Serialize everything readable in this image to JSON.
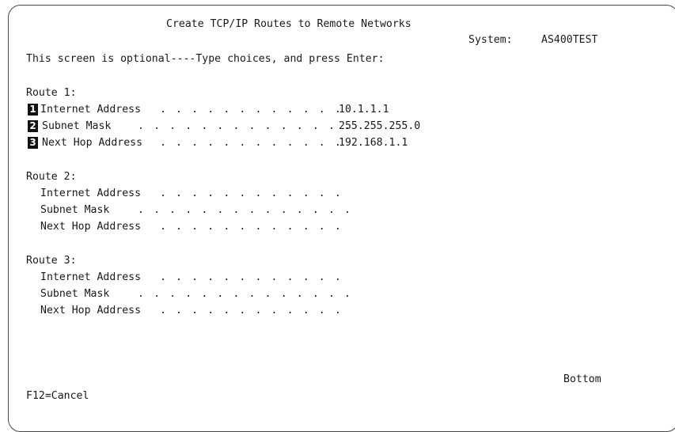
{
  "header": {
    "title": "Create TCP/IP Routes to Remote Networks",
    "system_label": "System:",
    "system_name": "AS400TEST",
    "instructions": "This screen is optional----Type choices, and press Enter:"
  },
  "routes": [
    {
      "label": "Route 1:",
      "fields": [
        {
          "callout": "1",
          "label": "Internet Address",
          "dots": ". . . . . . . . . . . .",
          "value": "10.1.1.1"
        },
        {
          "callout": "2",
          "label": "Subnet Mask",
          "dots": ". . . . . . . . . . . . . .",
          "value": "255.255.255.0"
        },
        {
          "callout": "3",
          "label": "Next Hop Address",
          "dots": ". . . . . . . . . . . .",
          "value": "192.168.1.1"
        }
      ]
    },
    {
      "label": "Route 2:",
      "fields": [
        {
          "label": "Internet Address",
          "dots": ". . . . . . . . . . . .",
          "value": ""
        },
        {
          "label": "Subnet Mask",
          "dots": ". . . . . . . . . . . . . .",
          "value": ""
        },
        {
          "label": "Next Hop Address",
          "dots": ". . . . . . . . . . . .",
          "value": ""
        }
      ]
    },
    {
      "label": "Route 3:",
      "fields": [
        {
          "label": "Internet Address",
          "dots": ". . . . . . . . . . . .",
          "value": ""
        },
        {
          "label": "Subnet Mask",
          "dots": ". . . . . . . . . . . . . .",
          "value": ""
        },
        {
          "label": "Next Hop Address",
          "dots": ". . . . . . . . . . . .",
          "value": ""
        }
      ]
    }
  ],
  "footer": {
    "scroll_indicator": "Bottom",
    "function_keys": "F12=Cancel"
  }
}
